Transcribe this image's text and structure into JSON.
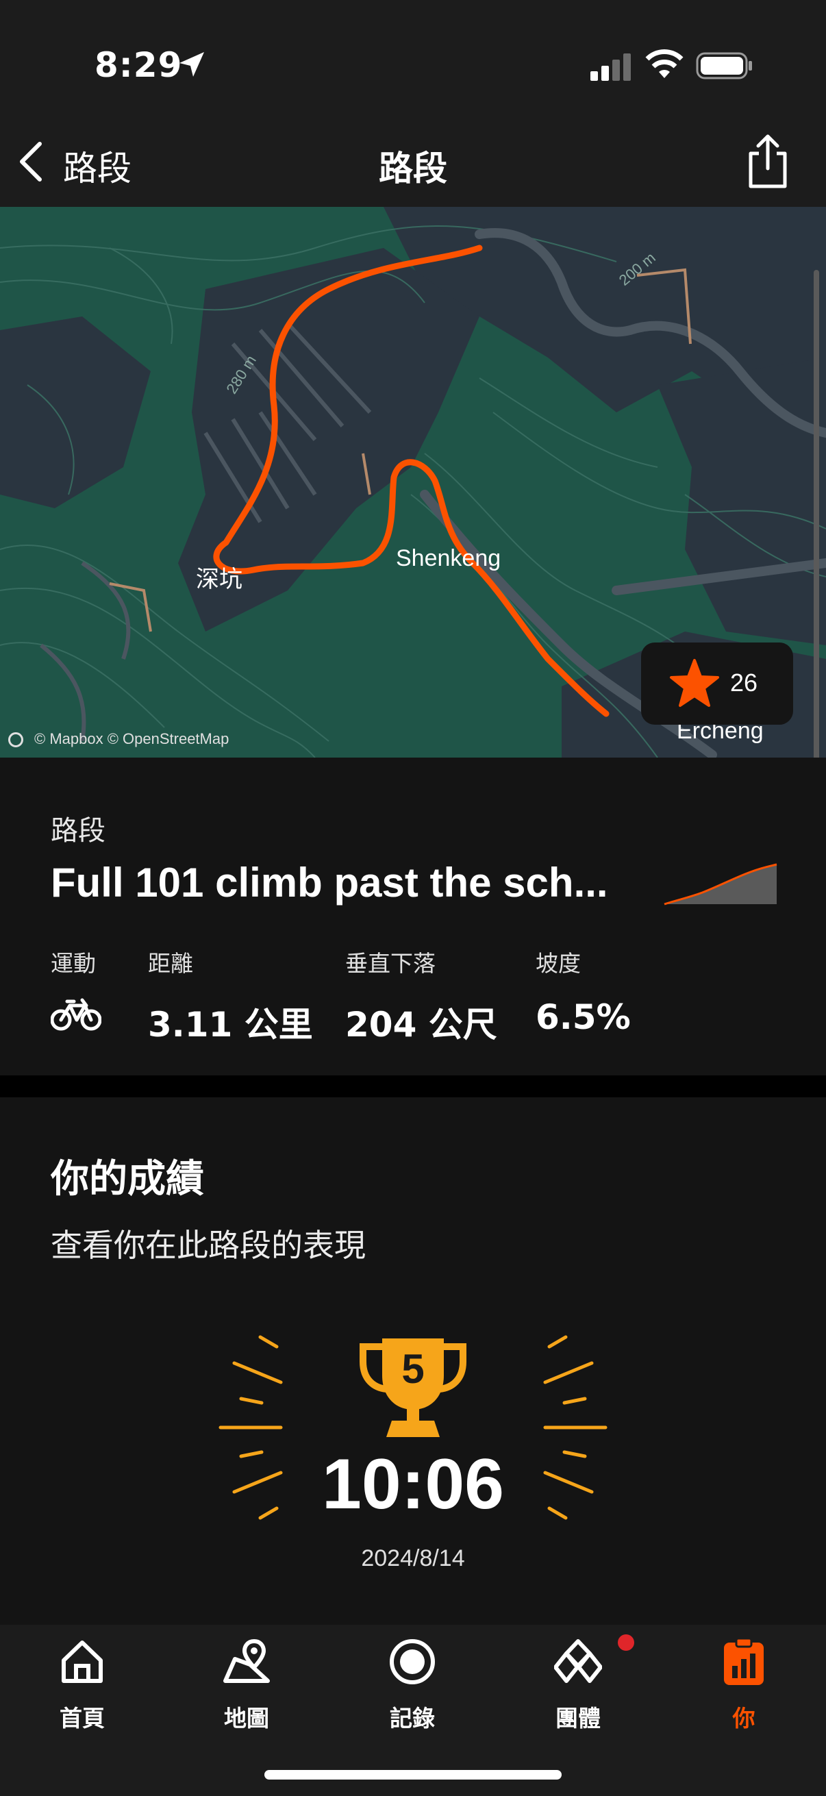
{
  "status_bar": {
    "time": "8:29"
  },
  "nav": {
    "back_label": "路段",
    "title": "路段"
  },
  "map": {
    "labels": {
      "place_1": "深坑",
      "place_2": "Shenkeng",
      "place_3": "Ercheng",
      "contour_1": "280 m",
      "contour_2": "200 m"
    },
    "attribution": "© Mapbox © OpenStreetMap",
    "star_count": "26",
    "route_color": "#fc5200"
  },
  "segment": {
    "label": "路段",
    "title": "Full 101 climb past the sch...",
    "stats": {
      "sport_label": "運動",
      "sport_icon": "bike-icon",
      "distance_label": "距離",
      "distance_value": "3.11 公里",
      "elevation_label": "垂直下落",
      "elevation_value": "204 公尺",
      "grade_label": "坡度",
      "grade_value": "6.5%"
    }
  },
  "achievements": {
    "title": "你的成績",
    "subtitle": "查看你在此路段的表現",
    "rank": "5",
    "time": "10:06",
    "date": "2024/8/14",
    "trophy_color": "#f6a51a"
  },
  "tabs": [
    {
      "label": "首頁",
      "icon": "home-icon"
    },
    {
      "label": "地圖",
      "icon": "map-icon"
    },
    {
      "label": "記錄",
      "icon": "record-icon"
    },
    {
      "label": "團體",
      "icon": "groups-icon"
    },
    {
      "label": "你",
      "icon": "you-icon",
      "active": true
    }
  ],
  "accent_color": "#fc5200"
}
